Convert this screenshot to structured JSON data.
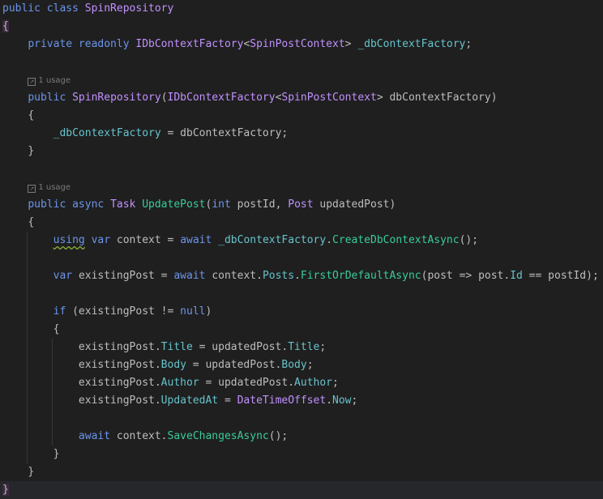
{
  "editor": {
    "colors": {
      "background": "#1f1f1f",
      "text": "#bdbdbd",
      "keyword": "#6c95eb",
      "type": "#c191ff",
      "field": "#66c3cc",
      "method": "#39cc9b"
    },
    "lines": [
      {
        "indent": 0,
        "tokens": [
          [
            "public class ",
            "kw"
          ],
          [
            "SpinRepository",
            "ty"
          ]
        ]
      },
      {
        "indent": 0,
        "tokens": [
          [
            "{",
            "br"
          ]
        ]
      },
      {
        "indent": 1,
        "tokens": [
          [
            "private readonly ",
            "kw"
          ],
          [
            "IDbContextFactory",
            "ty"
          ],
          [
            "<",
            ""
          ],
          [
            "SpinPostContext",
            "ty"
          ],
          [
            "> ",
            ""
          ],
          [
            "_dbContextFactory",
            "fd"
          ],
          [
            ";",
            ""
          ]
        ]
      },
      {
        "indent": 0,
        "tokens": []
      },
      {
        "indent": 1,
        "hint": "1 usage",
        "tokens": []
      },
      {
        "indent": 1,
        "tokens": [
          [
            "public ",
            "kw"
          ],
          [
            "SpinRepository",
            "ty"
          ],
          [
            "(",
            ""
          ],
          [
            "IDbContextFactory",
            "ty"
          ],
          [
            "<",
            ""
          ],
          [
            "SpinPostContext",
            "ty"
          ],
          [
            "> dbContextFactory)",
            ""
          ]
        ]
      },
      {
        "indent": 1,
        "tokens": [
          [
            "{",
            ""
          ]
        ]
      },
      {
        "indent": 2,
        "tokens": [
          [
            "_dbContextFactory",
            "fd"
          ],
          [
            " = dbContextFactory;",
            ""
          ]
        ]
      },
      {
        "indent": 1,
        "tokens": [
          [
            "}",
            ""
          ]
        ]
      },
      {
        "indent": 0,
        "tokens": []
      },
      {
        "indent": 1,
        "hint": "1 usage",
        "tokens": []
      },
      {
        "indent": 1,
        "tokens": [
          [
            "public async ",
            "kw"
          ],
          [
            "Task ",
            "ty"
          ],
          [
            "UpdatePost",
            "mt"
          ],
          [
            "(",
            ""
          ],
          [
            "int ",
            "kw"
          ],
          [
            "postId, ",
            ""
          ],
          [
            "Post ",
            "ty"
          ],
          [
            "updatedPost)",
            ""
          ]
        ]
      },
      {
        "indent": 1,
        "tokens": [
          [
            "{",
            ""
          ]
        ]
      },
      {
        "indent": 2,
        "tokens": [
          [
            "using",
            "kw warn"
          ],
          [
            " var ",
            "kw"
          ],
          [
            "context = ",
            ""
          ],
          [
            "await ",
            "kw"
          ],
          [
            "_dbContextFactory",
            "fd"
          ],
          [
            ".",
            ""
          ],
          [
            "CreateDbContextAsync",
            "mt"
          ],
          [
            "();",
            ""
          ]
        ]
      },
      {
        "indent": 0,
        "tokens": []
      },
      {
        "indent": 2,
        "tokens": [
          [
            "var ",
            "kw"
          ],
          [
            "existingPost = ",
            ""
          ],
          [
            "await ",
            "kw"
          ],
          [
            "context.",
            ""
          ],
          [
            "Posts",
            "fd"
          ],
          [
            ".",
            ""
          ],
          [
            "FirstOrDefaultAsync",
            "mt"
          ],
          [
            "(post => post.",
            ""
          ],
          [
            "Id",
            "fd"
          ],
          [
            " == postId);",
            ""
          ]
        ]
      },
      {
        "indent": 0,
        "tokens": []
      },
      {
        "indent": 2,
        "tokens": [
          [
            "if ",
            "kw"
          ],
          [
            "(existingPost != ",
            ""
          ],
          [
            "null",
            "kw"
          ],
          [
            ")",
            ""
          ]
        ]
      },
      {
        "indent": 2,
        "tokens": [
          [
            "{",
            ""
          ]
        ]
      },
      {
        "indent": 3,
        "tokens": [
          [
            "existingPost.",
            ""
          ],
          [
            "Title",
            "fd"
          ],
          [
            " = updatedPost.",
            ""
          ],
          [
            "Title",
            "fd"
          ],
          [
            ";",
            ""
          ]
        ]
      },
      {
        "indent": 3,
        "tokens": [
          [
            "existingPost.",
            ""
          ],
          [
            "Body",
            "fd"
          ],
          [
            " = updatedPost.",
            ""
          ],
          [
            "Body",
            "fd"
          ],
          [
            ";",
            ""
          ]
        ]
      },
      {
        "indent": 3,
        "tokens": [
          [
            "existingPost.",
            ""
          ],
          [
            "Author",
            "fd"
          ],
          [
            " = updatedPost.",
            ""
          ],
          [
            "Author",
            "fd"
          ],
          [
            ";",
            ""
          ]
        ]
      },
      {
        "indent": 3,
        "tokens": [
          [
            "existingPost.",
            ""
          ],
          [
            "UpdatedAt",
            "fd"
          ],
          [
            " = ",
            ""
          ],
          [
            "DateTimeOffset",
            "ty"
          ],
          [
            ".",
            ""
          ],
          [
            "Now",
            "fd"
          ],
          [
            ";",
            ""
          ]
        ]
      },
      {
        "indent": 0,
        "tokens": []
      },
      {
        "indent": 3,
        "tokens": [
          [
            "await ",
            "kw"
          ],
          [
            "context.",
            ""
          ],
          [
            "SaveChangesAsync",
            "mt"
          ],
          [
            "();",
            ""
          ]
        ]
      },
      {
        "indent": 2,
        "tokens": [
          [
            "}",
            ""
          ]
        ]
      },
      {
        "indent": 1,
        "tokens": [
          [
            "}",
            ""
          ]
        ]
      },
      {
        "indent": 0,
        "current": true,
        "tokens": [
          [
            "}",
            "br"
          ]
        ]
      }
    ]
  }
}
